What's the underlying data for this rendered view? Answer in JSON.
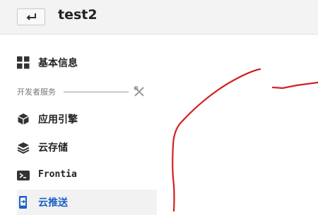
{
  "header": {
    "back_icon": "return-arrow-icon",
    "title": "test2"
  },
  "sidebar": {
    "items": [
      {
        "label": "基本信息",
        "icon": "grid-icon"
      },
      {
        "label": "应用引擎",
        "icon": "cube-icon"
      },
      {
        "label": "云存储",
        "icon": "layers-icon"
      },
      {
        "label": "Frontia",
        "icon": "terminal-icon"
      },
      {
        "label": "云推送",
        "icon": "phone-push-icon",
        "active": true
      }
    ],
    "section": {
      "label": "开发者服务",
      "icon": "tools-icon"
    }
  },
  "colors": {
    "accent": "#1b5fc4",
    "annotation": "#d42020"
  }
}
